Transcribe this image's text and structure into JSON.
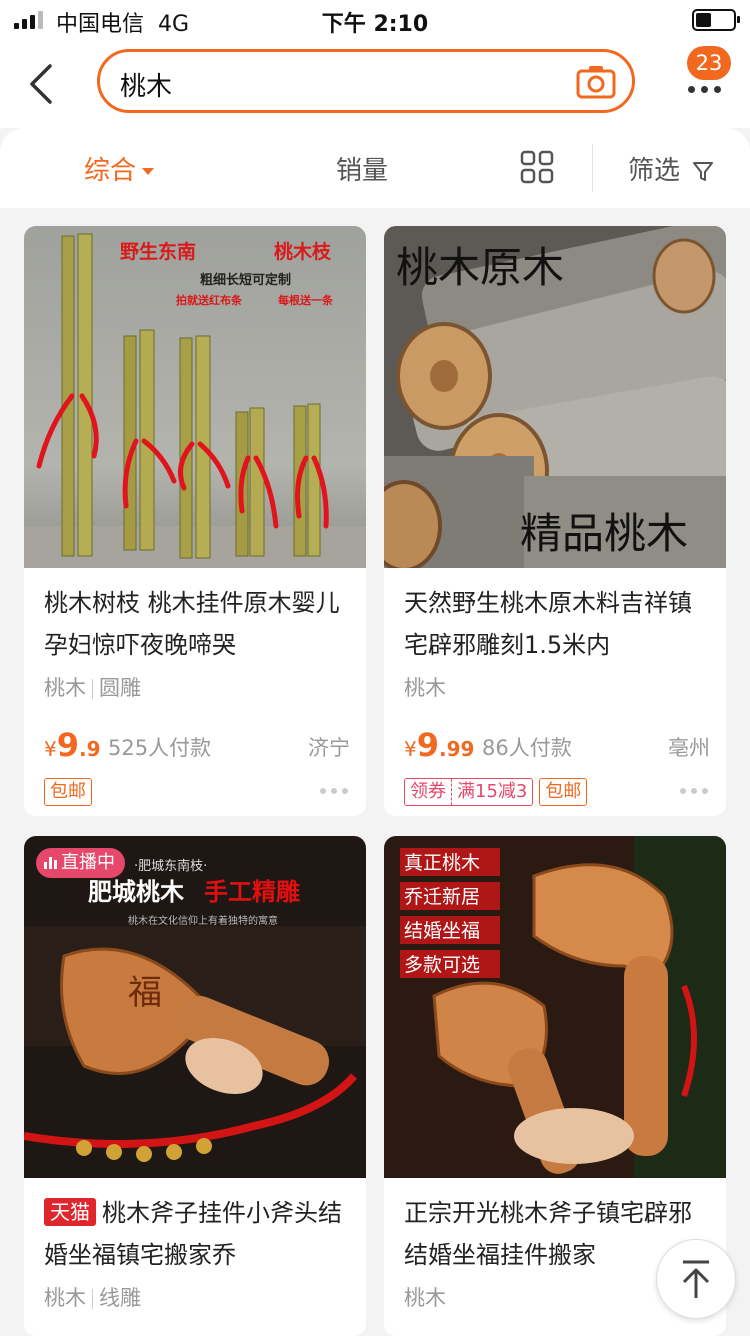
{
  "status_bar": {
    "carrier": "中国电信",
    "network": "4G",
    "time": "下午 2:10"
  },
  "header": {
    "search_query": "桃木",
    "notification_count": "23",
    "icons": {
      "back": "back-arrow-icon",
      "camera": "camera-icon",
      "more": "more-dots-icon"
    }
  },
  "filters": {
    "comprehensive": "综合",
    "sales": "销量",
    "filter": "筛选",
    "icons": {
      "view": "grid-view-icon",
      "filter": "funnel-icon"
    }
  },
  "products": [
    {
      "image_text": [
        "野生东南",
        "桃木枝",
        "粗细长短可定制",
        "拍就送红布条",
        "每根送一条"
      ],
      "title": "桃木树枝 桃木挂件原木婴儿孕妇惊吓夜晚啼哭",
      "tags": [
        "桃木",
        "圆雕"
      ],
      "price_int": "9",
      "price_dec": ".9",
      "sold": "525人付款",
      "location": "济宁",
      "badges": [
        "包邮"
      ]
    },
    {
      "image_text": [
        "桃木原木",
        "精品桃木"
      ],
      "title": "天然野生桃木原木料吉祥镇宅辟邪雕刻1.5米内",
      "tags": [
        "桃木"
      ],
      "price_int": "9",
      "price_dec": ".99",
      "sold": "86人付款",
      "location": "亳州",
      "coupon": [
        "领券",
        "满15减3"
      ],
      "badges": [
        "包邮"
      ]
    },
    {
      "image_text": [
        "·肥城东南枝·",
        "肥城桃木",
        "手工精雕",
        "桃木在文化信仰上有着独特的寓意",
        "福"
      ],
      "live_label": "直播中",
      "store_badge": "天猫",
      "title": "桃木斧子挂件小斧头结婚坐福镇宅搬家乔",
      "tags": [
        "桃木",
        "线雕"
      ]
    },
    {
      "image_text": [
        "真正桃木",
        "乔迁新居",
        "结婚坐福",
        "多款可选"
      ],
      "title": "正宗开光桃木斧子镇宅辟邪结婚坐福挂件搬家",
      "tags": [
        "桃木"
      ]
    }
  ],
  "back_to_top": {
    "icon": "arrow-up-icon"
  },
  "colors": {
    "accent": "#f2681f",
    "coupon": "#e5486b",
    "tmall": "#e0262d"
  }
}
